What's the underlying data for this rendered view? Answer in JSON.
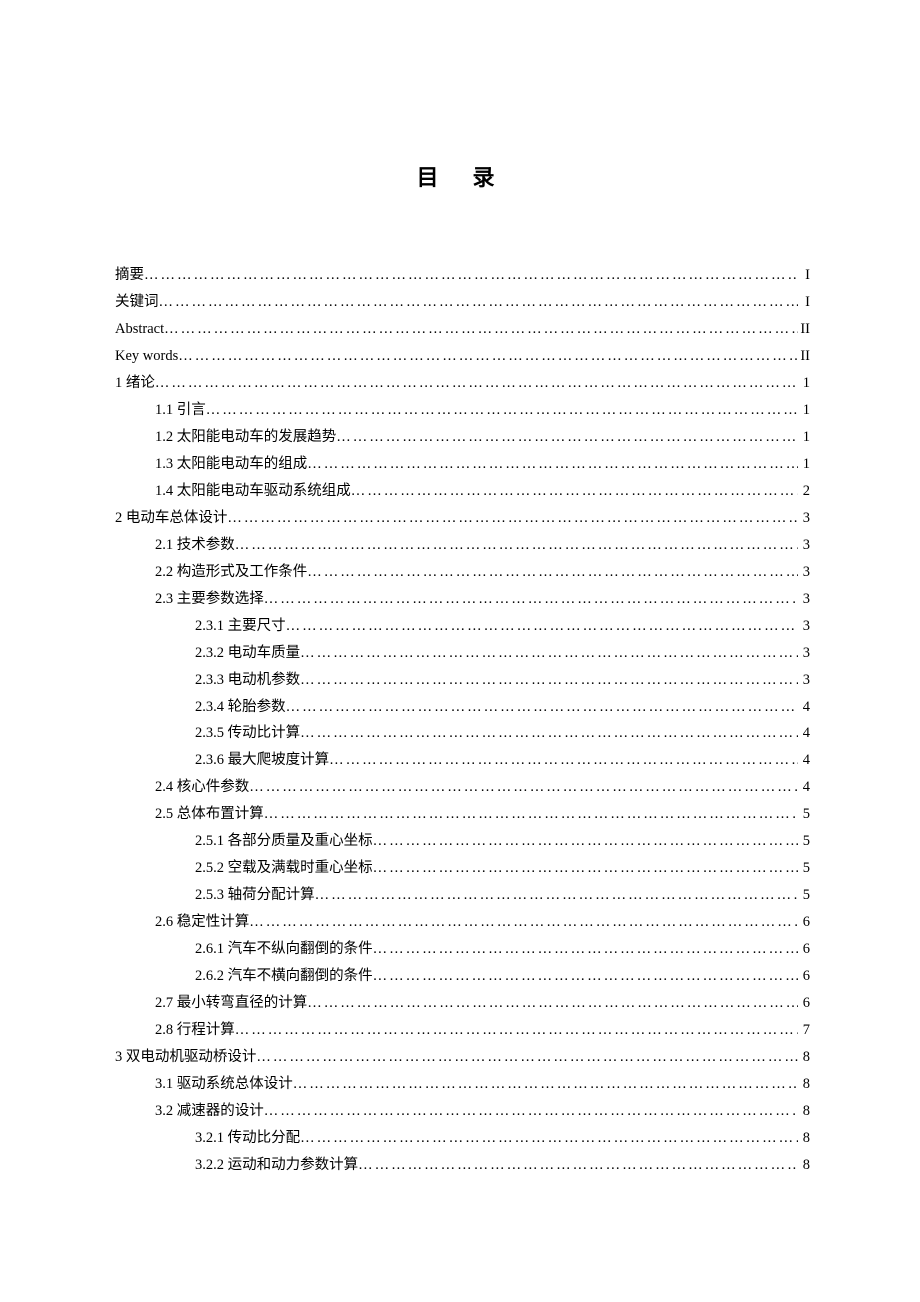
{
  "title": "目 录",
  "entries": [
    {
      "label": "摘要",
      "page": "I",
      "indent": 0
    },
    {
      "label": "关键词",
      "page": "I",
      "indent": 0
    },
    {
      "label": "Abstract",
      "page": "II",
      "indent": 0
    },
    {
      "label": "Key words",
      "page": "II",
      "indent": 0
    },
    {
      "label": "1 绪论",
      "page": "1",
      "indent": 0
    },
    {
      "label": "1.1 引言",
      "page": "1",
      "indent": 1
    },
    {
      "label": "1.2 太阳能电动车的发展趋势",
      "page": "1",
      "indent": 1
    },
    {
      "label": "1.3  太阳能电动车的组成",
      "page": "1",
      "indent": 1
    },
    {
      "label": "1.4  太阳能电动车驱动系统组成",
      "page": "2",
      "indent": 1
    },
    {
      "label": "2 电动车总体设计",
      "page": "3",
      "indent": 0
    },
    {
      "label": "2.1  技术参数",
      "page": "3",
      "indent": 1
    },
    {
      "label": "2.2  构造形式及工作条件",
      "page": "3",
      "indent": 1
    },
    {
      "label": "2.3 主要参数选择",
      "page": "3",
      "indent": 1
    },
    {
      "label": "2.3.1  主要尺寸",
      "page": "3",
      "indent": 2
    },
    {
      "label": "2.3.2  电动车质量",
      "page": "3",
      "indent": 2
    },
    {
      "label": "2.3.3  电动机参数",
      "page": "3",
      "indent": 2
    },
    {
      "label": "2.3.4  轮胎参数",
      "page": "4",
      "indent": 2
    },
    {
      "label": "2.3.5  传动比计算",
      "page": "4",
      "indent": 2
    },
    {
      "label": "2.3.6  最大爬坡度计算",
      "page": "4",
      "indent": 2
    },
    {
      "label": "2.4  核心件参数",
      "page": "4",
      "indent": 1
    },
    {
      "label": "2.5  总体布置计算",
      "page": "5",
      "indent": 1
    },
    {
      "label": "2.5.1  各部分质量及重心坐标",
      "page": "5",
      "indent": 2
    },
    {
      "label": "2.5.2  空载及满载时重心坐标",
      "page": "5",
      "indent": 2
    },
    {
      "label": "2.5.3  轴荷分配计算",
      "page": "5",
      "indent": 2
    },
    {
      "label": "2.6  稳定性计算",
      "page": " 6",
      "indent": 1
    },
    {
      "label": "2.6.1  汽车不纵向翻倒的条件",
      "page": "6",
      "indent": 2
    },
    {
      "label": "2.6.2  汽车不横向翻倒的条件",
      "page": "6",
      "indent": 2
    },
    {
      "label": "2.7  最小转弯直径的计算",
      "page": "6",
      "indent": 1
    },
    {
      "label": "2.8  行程计算",
      "page": "7",
      "indent": 1
    },
    {
      "label": "3  双电动机驱动桥设计",
      "page": "8",
      "indent": 0
    },
    {
      "label": "3.1  驱动系统总体设计",
      "page": "8",
      "indent": 1
    },
    {
      "label": "3.2  减速器的设计",
      "page": "8",
      "indent": 1
    },
    {
      "label": "3.2.1 传动比分配",
      "page": "8",
      "indent": 2
    },
    {
      "label": "3.2.2  运动和动力参数计算",
      "page": "8",
      "indent": 2
    }
  ]
}
